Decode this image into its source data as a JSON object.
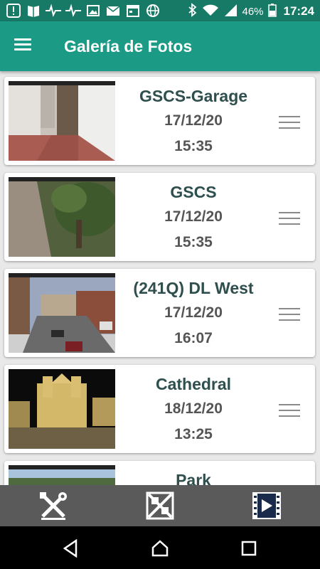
{
  "status_bar": {
    "battery": "46%",
    "time": "17:24",
    "left_icons": [
      "alert-icon",
      "book-icon",
      "pulse-icon",
      "pulse-icon",
      "image-icon",
      "mail-icon",
      "calendar-icon",
      "globe-icon"
    ],
    "right_icons": [
      "bluetooth-icon",
      "wifi-icon",
      "signal-icon",
      "battery-icon"
    ]
  },
  "app_bar": {
    "title": "Galería de Fotos",
    "menu_icon": "hamburger-menu-icon"
  },
  "cameras": [
    {
      "name": "GSCS-Garage",
      "date": "17/12/20",
      "time": "15:35"
    },
    {
      "name": "GSCS",
      "date": "17/12/20",
      "time": "15:35"
    },
    {
      "name": "(241Q) DL West",
      "date": "17/12/20",
      "time": "16:07"
    },
    {
      "name": "Cathedral",
      "date": "18/12/20",
      "time": "13:25"
    },
    {
      "name": "Park",
      "date": "",
      "time": ""
    }
  ],
  "bottom_bar": {
    "buttons": [
      "settings-tools-icon",
      "gallery-edit-icon",
      "video-play-icon"
    ]
  },
  "nav_bar": {
    "buttons": [
      "back-icon",
      "home-icon",
      "recents-icon"
    ]
  },
  "colors": {
    "status_bar": "#177a66",
    "app_bar": "#1b9a85",
    "card_text": "#2f4f4f",
    "bottom_bar": "#5a5a5a"
  }
}
